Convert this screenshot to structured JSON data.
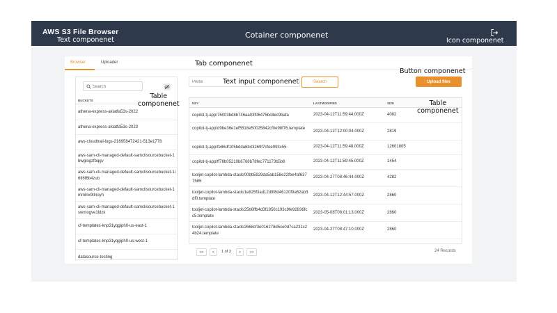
{
  "header": {
    "title": "AWS S3 File Browser",
    "subtitle_annotation": "Text componenet",
    "container_annotation": "Cotainer componenet",
    "icon_annotation": "Icon componenet",
    "logout_icon": "logout-icon"
  },
  "tabs": {
    "annotation": "Tab componenet",
    "items": [
      {
        "label": "Browser",
        "active": true
      },
      {
        "label": "Uploader",
        "active": false
      }
    ],
    "accent": "#e8912d"
  },
  "buckets": {
    "search_placeholder": "Search",
    "table_annotation_line1": "Table",
    "table_annotation_line2": "componenet",
    "header": "BUCKETS",
    "items": [
      "athena-express-akiatfa53s-2022",
      "athena-express-akiatfa53s-2023",
      "aws-cloudtrail-logs-216958472421-513e1778",
      "aws-sam-cli-managed-default-samclisourcebucket-1bwglogzfbqgv",
      "aws-sam-cli-managed-default-samclisourcebucket-1i6tl6f6b4zub",
      "aws-sam-cli-managed-default-samclisourcebucket-1mmlnx9tlnoyh",
      "aws-sam-cli-managed-default-samclisourcebucket-1swmogve1ldzk",
      "cf-templates-knp31yqgiph0-us-east-1",
      "cf-templates-knp31yqgiph0-us-west-1",
      "datasource-testing"
    ]
  },
  "search": {
    "prefix_placeholder": "Prefix",
    "text_input_annotation": "Text input componenet",
    "search_label": "Search",
    "button_annotation": "Button componenet",
    "upload_label": "Upload files"
  },
  "files": {
    "table_annotation_line1": "Table",
    "table_annotation_line2": "componenet",
    "columns": [
      "KEY",
      "LASTMODIFIED",
      "SIZE"
    ],
    "rows": [
      {
        "key": "copilot-tj-app/76003bd8b746aa03f06475bc8ec9bafa",
        "modified": "2023-04-12T11:59:44.000Z",
        "size": "4082"
      },
      {
        "key": "copilot-tj-app/d9be36e1ef5518e50025842cf0e98f76.template",
        "modified": "2023-04-12T12:00:04.000Z",
        "size": "2819"
      },
      {
        "key": "copilot-tj-app/fe86df105bdda6b43269f7cfee993c55",
        "modified": "2023-04-12T11:59:48.000Z",
        "size": "12601805"
      },
      {
        "key": "copilot-tj-app/ff78b05210b6768b78fec771173b5b6",
        "modified": "2023-04-12T11:59:45.000Z",
        "size": "1454"
      },
      {
        "key": "tooljet-copilot-lambda-stack/00bb5929da5ab158e22fbe4af6377585",
        "modified": "2023-04-27T08:46:44.000Z",
        "size": "4282"
      },
      {
        "key": "tooljet-copilot-lambda-stack/1e825f3ad12d9f8d46120f9a62ab3df0.template",
        "modified": "2023-04-12T12:44:57.000Z",
        "size": "2860"
      },
      {
        "key": "tooljet-copilot-lambda-stack/25b6ffb4d3f1850c193c9fe92836fcc5.template",
        "modified": "2023-05-08T08:01:13.000Z",
        "size": "2860"
      },
      {
        "key": "tooljet-copilot-lambda-stack/2668cf3e016278d5ce0d7ca231c24b24.template",
        "modified": "2023-04-27T08:47:10.000Z",
        "size": "2860"
      }
    ],
    "pager": {
      "first": "<<",
      "prev": "<",
      "page_label": "1 of 3",
      "next": ">",
      "last": ">>"
    },
    "records": "24 Records"
  }
}
